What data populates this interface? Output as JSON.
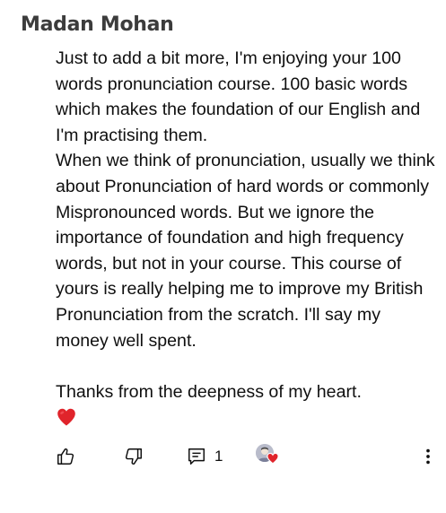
{
  "comment": {
    "author": "Madan Mohan",
    "paragraph_1": "Just to add a bit more, I'm enjoying your 100 words pronunciation course. 100 basic words which makes the foundation of our English and I'm practising them.",
    "paragraph_2": "When we think of pronunciation, usually we think about Pronunciation of hard words or commonly Mispronounced words. But we ignore the importance of foundation and high frequency words, but not in your course. This course of yours is really helping me to improve my British Pronunciation from the scratch. I'll say my money well spent.",
    "paragraph_3": "Thanks from the deepness of my heart.",
    "heart_emoji": "heart-emoji",
    "reply_count": "1"
  },
  "colors": {
    "heart": "#e0242b",
    "text": "#0f0f0f",
    "author": "#3c3c3c"
  },
  "icons": {
    "like": "thumbs-up-icon",
    "dislike": "thumbs-down-icon",
    "reply": "comment-icon",
    "creator_heart": "creator-heart-avatar",
    "more": "more-vert-icon"
  }
}
